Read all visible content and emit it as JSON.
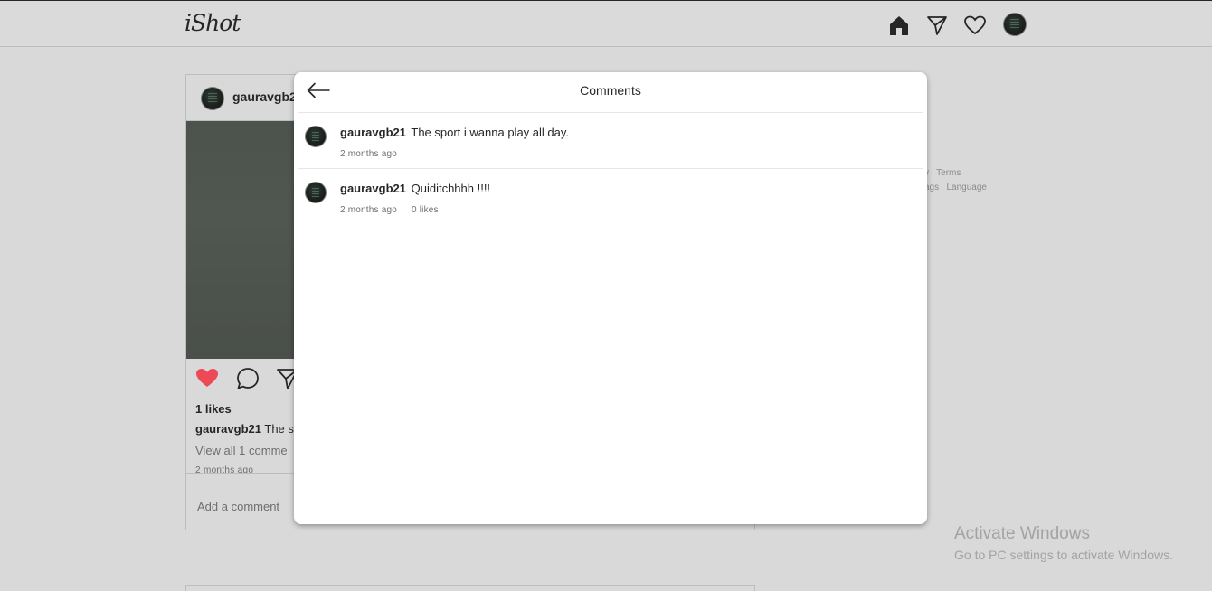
{
  "app": {
    "logo": "iShot"
  },
  "nav": {
    "icons": [
      "home-icon",
      "direct-message-icon",
      "activity-heart-icon",
      "profile-avatar"
    ]
  },
  "post": {
    "username": "gauravgb2",
    "likes": "1 likes",
    "caption_user": "gauravgb21",
    "caption_text": "The s",
    "view_all": "View all 1 comme",
    "time": "2 months ago",
    "add_comment_placeholder": "Add a comment"
  },
  "footer": {
    "line1": "y   Terms",
    "line2": "ags   Language"
  },
  "modal": {
    "title": "Comments",
    "comments": [
      {
        "user": "gauravgb21",
        "text": "The sport i wanna play all day.",
        "time": "2 months ago",
        "likes": ""
      },
      {
        "user": "gauravgb21",
        "text": "Quiditchhhh !!!!",
        "time": "2 months ago",
        "likes": "0 likes"
      }
    ]
  },
  "watermark": {
    "title": "Activate Windows",
    "subtitle": "Go to PC settings to activate Windows."
  },
  "colors": {
    "heart": "#ed4956",
    "overlay": "#d9d9d9",
    "modal_bg": "#ffffff"
  }
}
